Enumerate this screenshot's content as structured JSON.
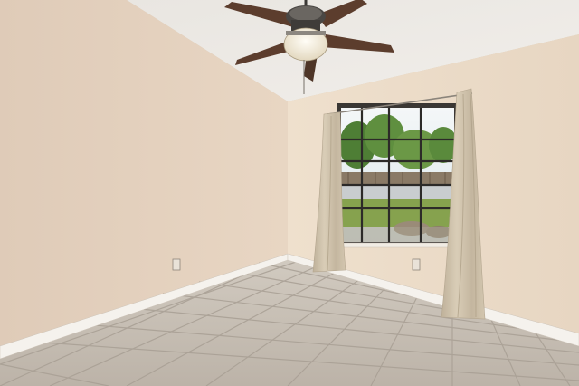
{
  "scene": {
    "description_colors": {
      "left_wall": "#e4d2bf",
      "right_wall": "#ecdcc8",
      "ceiling": "#ebe7e1",
      "floor_tile": "#c7bfb4",
      "grout": "#a79e93",
      "baseboard": "#f4f1ec",
      "curtain": "#cfc2ab",
      "window_frame": "#2c2a28",
      "fan_blade": "#5a3b2c",
      "sky": "#cfe3ee",
      "foliage": "#5f8a3f"
    }
  }
}
